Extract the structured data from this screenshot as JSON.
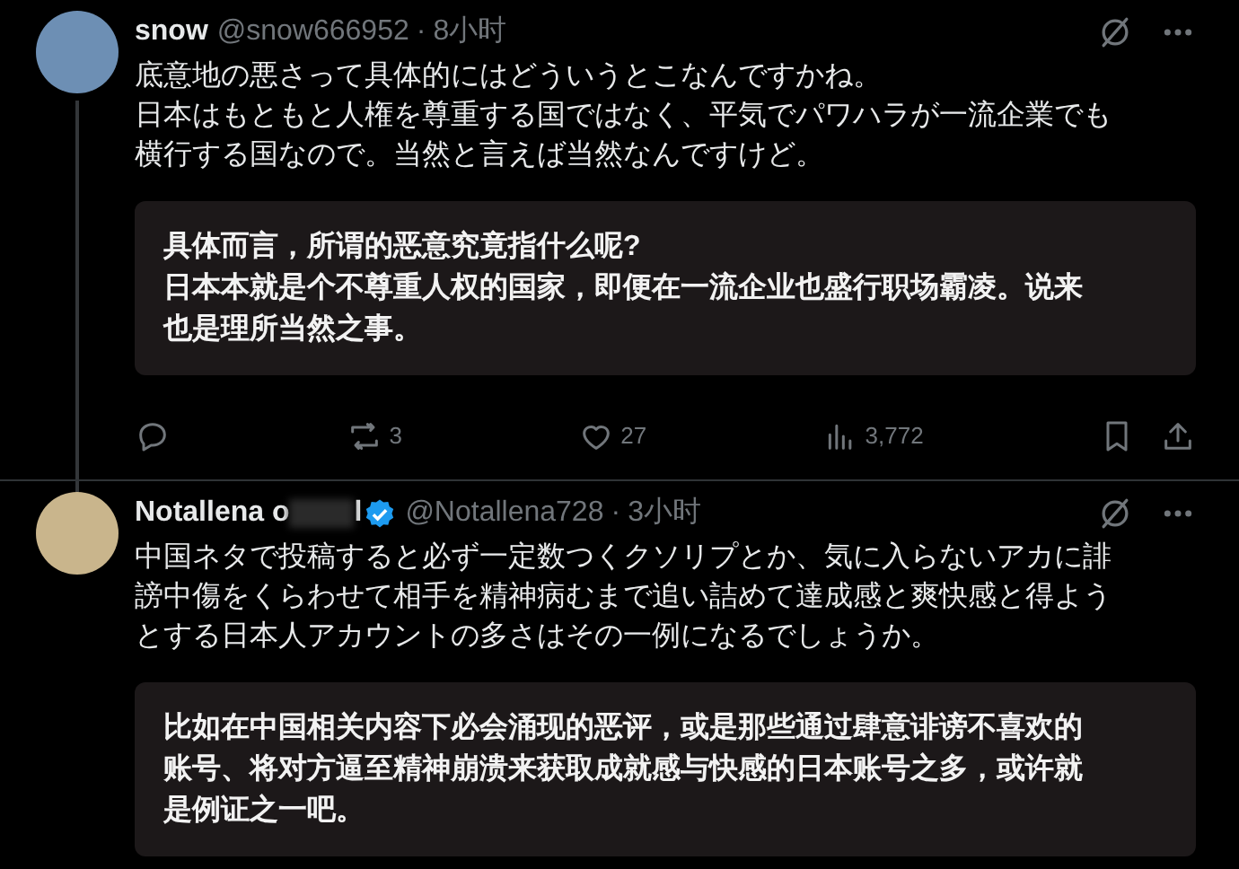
{
  "posts": [
    {
      "name_parts": [
        "snow"
      ],
      "redacted": false,
      "verified": false,
      "handle": "@snow666952",
      "separator": "·",
      "time": "8小时",
      "thread_line": true,
      "text": [
        "底意地の悪さって具体的にはどういうとこなんですかね。",
        "日本はもともと人権を尊重する国ではなく、平気でパワハラが一流企業でも",
        "横行する国なので。当然と言えば当然なんですけど。"
      ],
      "translation": [
        "具体而言，所谓的恶意究竟指什么呢?",
        "日本本就是个不尊重人权的国家，即便在一流企业也盛行职场霸凌。说来",
        "也是理所当然之事。"
      ],
      "actions": {
        "reposts": "3",
        "likes": "27",
        "views": "3,772"
      }
    },
    {
      "name_parts": [
        "Notallena o",
        "l"
      ],
      "redacted": true,
      "verified": true,
      "handle": "@Notallena728",
      "separator": "·",
      "time": "3小时",
      "thread_line": false,
      "text": [
        "中国ネタで投稿すると必ず一定数つくクソリプとか、気に入らないアカに誹",
        "謗中傷をくらわせて相手を精神病むまで追い詰めて達成感と爽快感と得よう",
        "とする日本人アカウントの多さはその一例になるでしょうか。"
      ],
      "translation": [
        "比如在中国相关内容下必会涌现的恶评，或是那些通过肆意诽谤不喜欢的",
        "账号、将对方逼至精神崩溃来获取成就感与快感的日本账号之多，或许就",
        "是例证之一吧。"
      ]
    }
  ]
}
